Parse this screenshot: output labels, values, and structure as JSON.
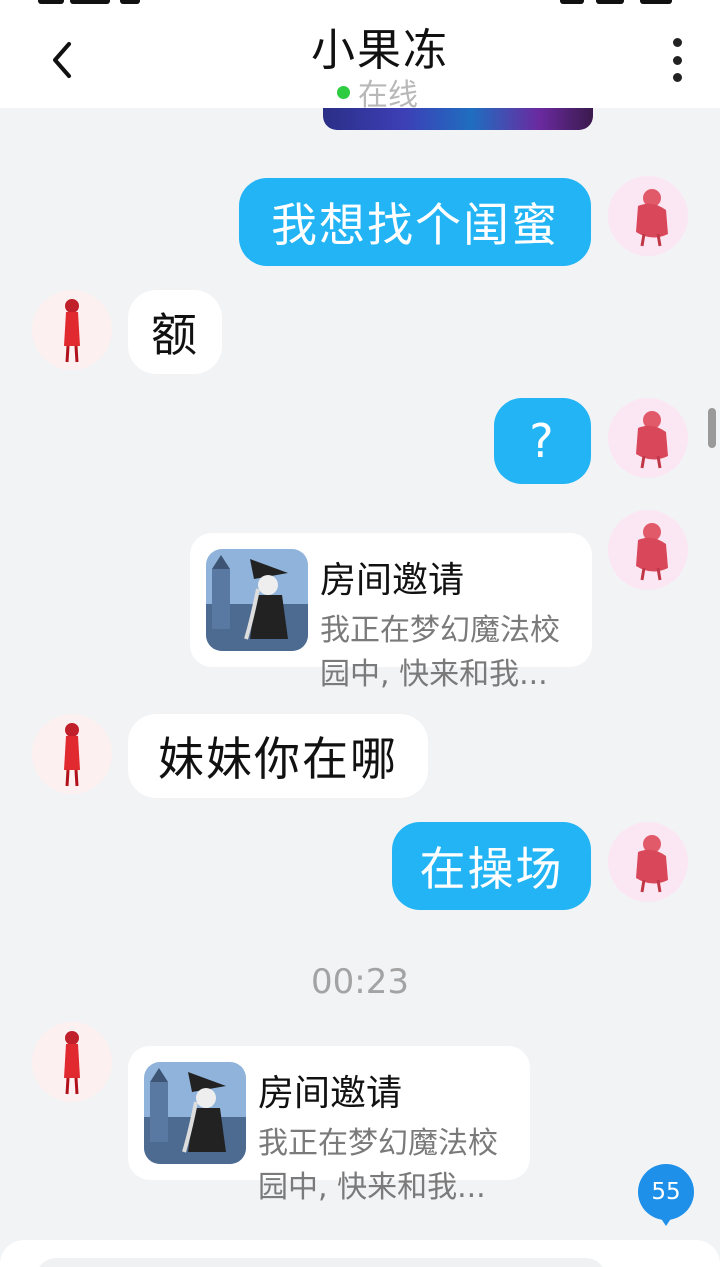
{
  "header": {
    "title": "小果冻",
    "status": "在线",
    "status_color": "#2ecc40"
  },
  "messages": [
    {
      "side": "right",
      "type": "text",
      "text": "我想找个闺蜜"
    },
    {
      "side": "left",
      "type": "text",
      "text": "额"
    },
    {
      "side": "right",
      "type": "text",
      "text": "?"
    },
    {
      "side": "right",
      "type": "card",
      "title": "房间邀请",
      "desc": "我正在梦幻魔法校园中, 快来和我..."
    },
    {
      "side": "left",
      "type": "text",
      "text": "妹妹你在哪"
    },
    {
      "side": "right",
      "type": "text",
      "text": "在操场"
    },
    {
      "side": "left",
      "type": "card",
      "title": "房间邀请",
      "desc": "我正在梦幻魔法校园中, 快来和我..."
    }
  ],
  "time_label": "00:23",
  "unread_count": "55",
  "colors": {
    "accent_blue": "#22b4f4",
    "background": "#f2f3f5",
    "badge": "#1e90ea"
  },
  "icons": {
    "back": "chevron-left-icon",
    "more": "more-vertical-icon"
  }
}
